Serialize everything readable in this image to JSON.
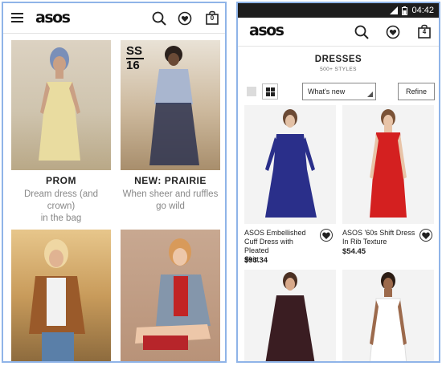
{
  "left_screen": {
    "header": {
      "logo": "asos",
      "bag_count": "0"
    },
    "tiles": [
      {
        "title": "PROM",
        "subtitle_line1": "Dream dress (and crown)",
        "subtitle_line2": "in the bag"
      },
      {
        "badge_line1": "SS",
        "badge_line2": "16",
        "title": "NEW: PRAIRIE",
        "subtitle_line1": "When sheer and ruffles",
        "subtitle_line2": "go wild"
      },
      {
        "title": "",
        "subtitle_line1": "",
        "subtitle_line2": ""
      },
      {
        "title": "",
        "subtitle_line1": "",
        "subtitle_line2": ""
      }
    ]
  },
  "right_screen": {
    "status_bar": {
      "time": "04:42"
    },
    "header": {
      "logo": "asos",
      "bag_count": "4"
    },
    "page": {
      "title": "DRESSES",
      "subtitle": "500+ STYLES"
    },
    "sort": {
      "selected": "What's new"
    },
    "refine_label": "Refine",
    "products": [
      {
        "name_line1": "ASOS Embellished",
        "name_line2": "Cuff Dress with Pleated",
        "name_line3": "Skirt",
        "price": "$93.34",
        "color": "#2a2f8a"
      },
      {
        "name_line1": "ASOS '60s Shift Dress",
        "name_line2": "In Rib Texture",
        "name_line3": "",
        "price": "$54.45",
        "color": "#d42020"
      },
      {
        "name_line1": "",
        "name_line2": "",
        "name_line3": "",
        "price": "",
        "color": "#3a1d22"
      },
      {
        "name_line1": "",
        "name_line2": "",
        "name_line3": "",
        "price": "",
        "color": "#f2f2f2"
      }
    ]
  }
}
